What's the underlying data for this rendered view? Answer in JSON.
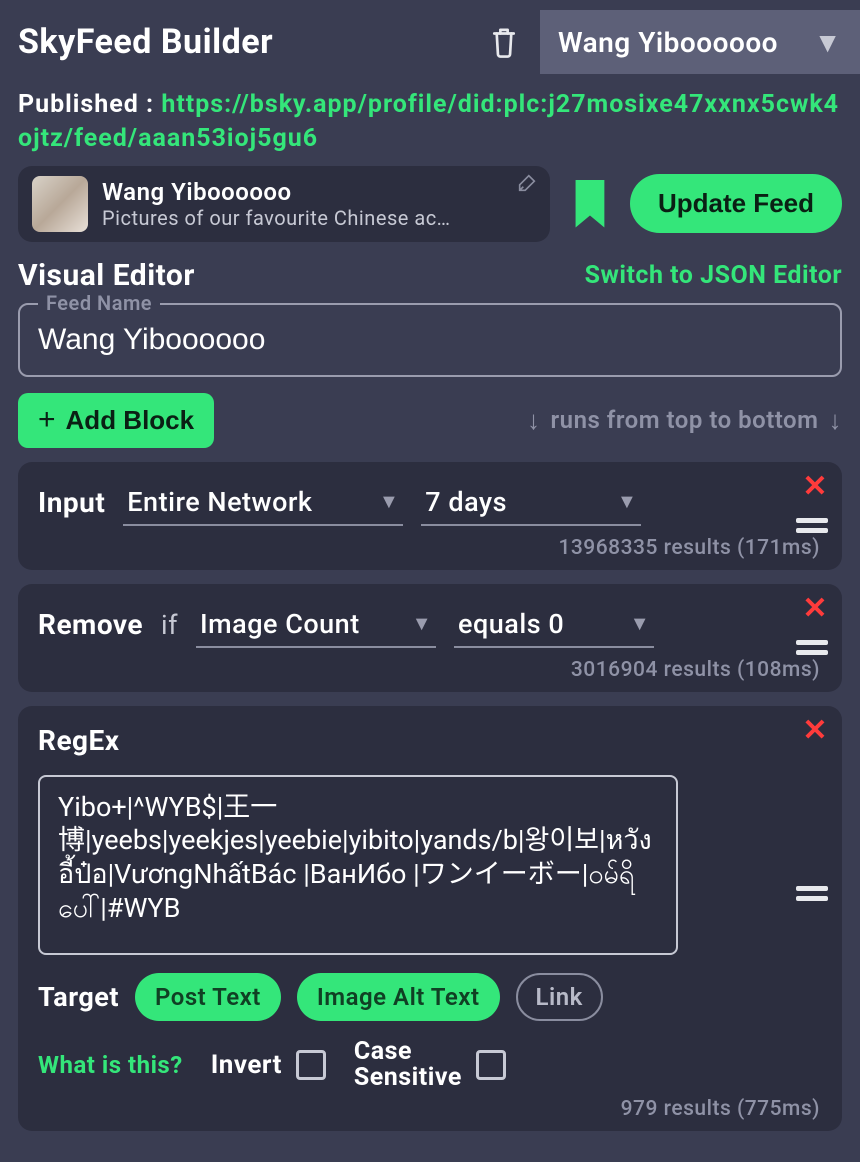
{
  "app": {
    "title": "SkyFeed Builder"
  },
  "header": {
    "selected_feed": "Wang Yiboooooo",
    "published_label": "Published :",
    "published_url": "https://bsky.app/profile/did:plc:j27mosixe47xxnx5cwk4ojtz/feed/aaan53ioj5gu6",
    "feed_card": {
      "title": "Wang Yiboooooo",
      "description": "Pictures of our favourite Chinese ac…"
    },
    "update_button": "Update Feed"
  },
  "editor": {
    "title": "Visual Editor",
    "switch_link": "Switch to JSON Editor",
    "feed_name_label": "Feed Name",
    "feed_name_value": "Wang Yiboooooo",
    "add_block": "Add Block",
    "runs_hint": "runs from top to bottom"
  },
  "blocks": [
    {
      "type": "input",
      "label": "Input",
      "source": "Entire Network",
      "duration": "7 days",
      "results": "13968335 results (171ms)"
    },
    {
      "type": "remove",
      "label": "Remove",
      "if_word": "if",
      "field": "Image Count",
      "op": "equals",
      "value": "0",
      "results": "3016904 results (108ms)"
    },
    {
      "type": "regex",
      "label": "RegEx",
      "pattern": "Yibo+|^WYB$|王一博|yeebs|yeekjes|yeebie|yibito|yands/b|왕이보|หวังอี้ป๋อ|VươngNhấtBác |ВанИбо |ワンイーボー|ဝမ်ရိပေါ်|#WYB",
      "target_label": "Target",
      "targets": {
        "post_text": {
          "label": "Post Text",
          "on": true
        },
        "image_alt": {
          "label": "Image Alt Text",
          "on": true
        },
        "link": {
          "label": "Link",
          "on": false
        }
      },
      "what_is_this": "What is this?",
      "invert_label": "Invert",
      "case_label": "Case\nSensitive",
      "results": "979 results (775ms)"
    }
  ]
}
